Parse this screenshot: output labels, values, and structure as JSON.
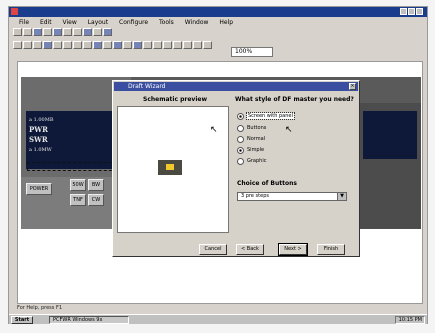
{
  "window": {
    "title": ""
  },
  "menu": [
    "File",
    "Edit",
    "View",
    "Layout",
    "Configure",
    "Tools",
    "Window",
    "Help"
  ],
  "toolbar": {
    "zoom_value": "100%"
  },
  "device": {
    "lcd_line1": "a 1.00MB",
    "lcd_line2": "PWR",
    "lcd_line3": "SWR",
    "lcd_line4": "a 1.0MW",
    "power_label": "POWER",
    "btn_a": "50W",
    "btn_b": "TNF",
    "btn_c": "BW",
    "btn_d": "CW"
  },
  "dialog": {
    "title": "Draft Wizard",
    "preview_label": "Schematic preview",
    "question": "What style of DF master you need?",
    "radio_options": [
      {
        "label": "Screen with panel",
        "checked": true
      },
      {
        "label": "Buttons",
        "checked": false
      },
      {
        "label": "Normal",
        "checked": false
      },
      {
        "label": "Simple",
        "checked": true
      },
      {
        "label": "Graphic",
        "checked": false
      }
    ],
    "select_label": "Choice of Buttons",
    "select_value": "3 pre steps",
    "buttons": {
      "cancel": "Cancel",
      "back": "< Back",
      "next": "Next >",
      "finish": "Finish"
    }
  },
  "statusbar": {
    "text": "For Help, press F1"
  },
  "taskbar": {
    "start": "Start",
    "task": "PCFWR Windows 9x",
    "clock": "10:15 PM"
  }
}
